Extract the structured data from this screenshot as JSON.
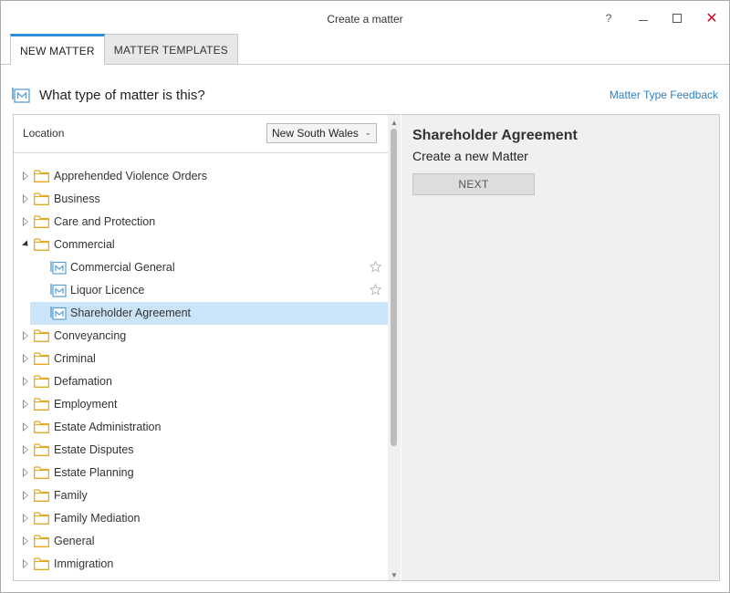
{
  "window": {
    "title": "Create a matter",
    "help_glyph": "?",
    "close_glyph": "✕"
  },
  "tabs": [
    {
      "label": "NEW MATTER",
      "active": true
    },
    {
      "label": "MATTER TEMPLATES",
      "active": false
    }
  ],
  "heading": {
    "text": "What type of matter is this?",
    "icon": "matter-icon",
    "feedback_link": "Matter Type Feedback"
  },
  "location": {
    "label": "Location",
    "selected": "New South Wales"
  },
  "tree": {
    "folders": [
      {
        "label": "Apprehended Violence Orders",
        "expanded": false
      },
      {
        "label": "Business",
        "expanded": false
      },
      {
        "label": "Care and Protection",
        "expanded": false
      },
      {
        "label": "Commercial",
        "expanded": true,
        "children": [
          {
            "label": "Commercial General",
            "selected": false
          },
          {
            "label": "Liquor Licence",
            "selected": false
          },
          {
            "label": "Shareholder Agreement",
            "selected": true
          }
        ]
      },
      {
        "label": "Conveyancing",
        "expanded": false
      },
      {
        "label": "Criminal",
        "expanded": false
      },
      {
        "label": "Defamation",
        "expanded": false
      },
      {
        "label": "Employment",
        "expanded": false
      },
      {
        "label": "Estate Administration",
        "expanded": false
      },
      {
        "label": "Estate Disputes",
        "expanded": false
      },
      {
        "label": "Estate Planning",
        "expanded": false
      },
      {
        "label": "Family",
        "expanded": false
      },
      {
        "label": "Family Mediation",
        "expanded": false
      },
      {
        "label": "General",
        "expanded": false
      },
      {
        "label": "Immigration",
        "expanded": false
      }
    ]
  },
  "detail": {
    "title": "Shareholder Agreement",
    "subtitle": "Create a new Matter",
    "next_label": "NEXT"
  },
  "colors": {
    "accent": "#2f8ed4",
    "link": "#2f7fc0",
    "selected_row": "#cce4f7",
    "folder": "#e8a825",
    "close": "#c8102e"
  }
}
